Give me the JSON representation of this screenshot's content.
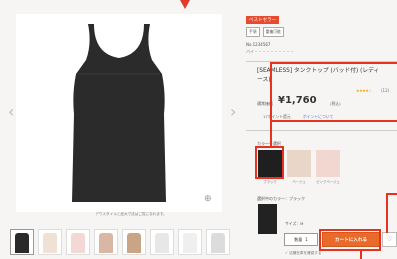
{
  "labels": {
    "badge": "ベストセラー",
    "tags": [
      "手頃",
      "重複可能"
    ],
    "code": "No.1234567",
    "sub": "バイ・・・・・・・・・・",
    "product_name": "[SEAMLESS] タンクトップ (バッド付) (レディース)",
    "stars": "★★★★☆",
    "rating": "(12)",
    "price_label": "通常価格",
    "price": "¥1,760",
    "tax": "(税込)",
    "points": "17ポイント還元",
    "points_link": "ポイントについて",
    "color_label": "カラーを選択",
    "swatch_labels": [
      "ブラック",
      "ベージュ",
      "ピンクベージュ"
    ],
    "selected_label": "選択中のカラー：ブラック",
    "size": "サイズ：M",
    "qty_label": "数量",
    "qty": "1",
    "cart": "カートに入れる",
    "fav": "♡",
    "bottom_note": "✓ 店舗在庫を確認する",
    "img_note": "アウスタイルと品大寸法はご覧になれます。",
    "zoom": "⊕",
    "prev": "‹",
    "next": "›"
  },
  "colors": {
    "accent": "#e96b2b",
    "highlight": "#e53221",
    "badge": "#e54b2e",
    "swatches": [
      "#1f1f1f",
      "#e9d6c8",
      "#f1d7cf"
    ]
  },
  "thumbnails": [
    {
      "color": "#2a2a2a",
      "icon": "tank-top-black"
    },
    {
      "color": "#efe1d4",
      "icon": "tank-top-beige"
    },
    {
      "color": "#f4d8d5",
      "icon": "tank-top-pink"
    },
    {
      "color": "#d9b7a4",
      "icon": "tank-top-side"
    },
    {
      "color": "#c9a585",
      "icon": "tank-top-fabric"
    },
    {
      "color": "#e7e7e7",
      "icon": "tank-top-detail"
    },
    {
      "color": "#efefef",
      "icon": "tank-top-white"
    },
    {
      "color": "#dcdcdc",
      "icon": "tank-top-lay"
    }
  ]
}
